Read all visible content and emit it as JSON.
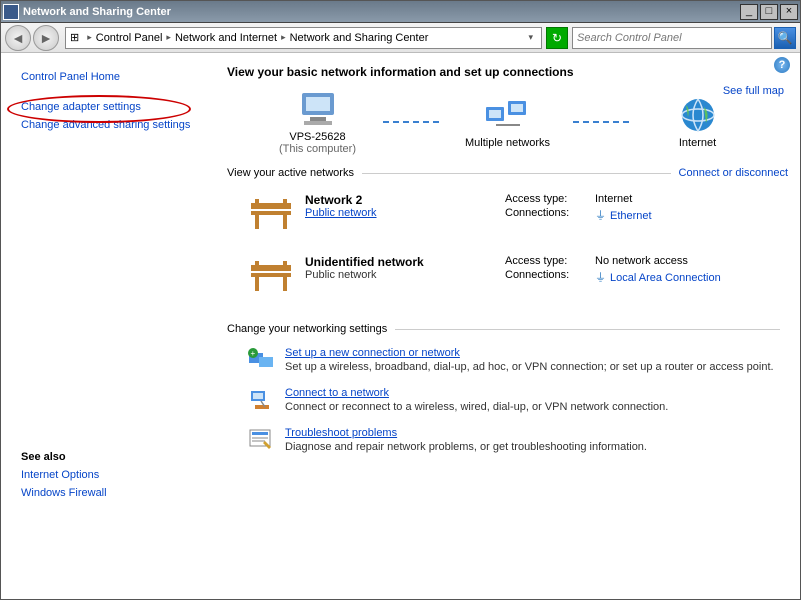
{
  "window": {
    "title": "Network and Sharing Center"
  },
  "toolbar": {
    "breadcrumb": [
      "Control Panel",
      "Network and Internet",
      "Network and Sharing Center"
    ],
    "search_placeholder": "Search Control Panel"
  },
  "sidebar": {
    "home": "Control Panel Home",
    "links": [
      "Change adapter settings",
      "Change advanced sharing settings"
    ],
    "seealso_hdr": "See also",
    "seealso": [
      "Internet Options",
      "Windows Firewall"
    ]
  },
  "main": {
    "heading": "View your basic network information and set up connections",
    "map_link": "See full map",
    "map": {
      "left": {
        "name": "VPS-25628",
        "sub": "(This computer)"
      },
      "mid": {
        "name": "Multiple networks",
        "sub": ""
      },
      "right": {
        "name": "Internet",
        "sub": ""
      }
    },
    "active_hdr": "View your active networks",
    "active_link": "Connect or disconnect",
    "networks": [
      {
        "name": "Network  2",
        "type": "Public network",
        "type_link": true,
        "access_label": "Access type:",
        "access_value": "Internet",
        "conn_label": "Connections:",
        "conn_value": "Ethernet",
        "conn_link": true
      },
      {
        "name": "Unidentified network",
        "type": "Public network",
        "type_link": false,
        "access_label": "Access type:",
        "access_value": "No network access",
        "conn_label": "Connections:",
        "conn_value": "Local Area Connection",
        "conn_link": true
      }
    ],
    "settings_hdr": "Change your networking settings",
    "actions": [
      {
        "title": "Set up a new connection or network",
        "desc": "Set up a wireless, broadband, dial-up, ad hoc, or VPN connection; or set up a router or access point."
      },
      {
        "title": "Connect to a network",
        "desc": "Connect or reconnect to a wireless, wired, dial-up, or VPN network connection."
      },
      {
        "title": "Troubleshoot problems",
        "desc": "Diagnose and repair network problems, or get troubleshooting information."
      }
    ]
  }
}
